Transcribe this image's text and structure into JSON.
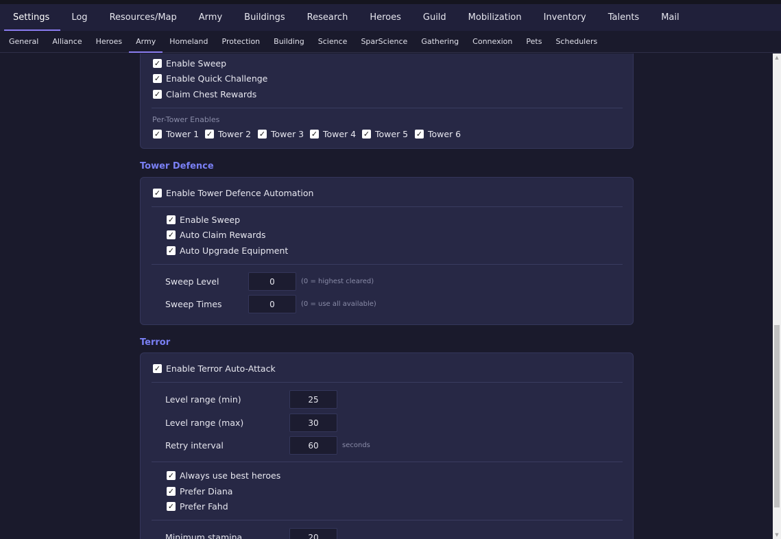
{
  "top_tabs": [
    "Settings",
    "Log",
    "Resources/Map",
    "Army",
    "Buildings",
    "Research",
    "Heroes",
    "Guild",
    "Mobilization",
    "Inventory",
    "Talents",
    "Mail"
  ],
  "sub_tabs": [
    "General",
    "Alliance",
    "Heroes",
    "Army",
    "Homeland",
    "Protection",
    "Building",
    "Science",
    "SparScience",
    "Gathering",
    "Connexion",
    "Pets",
    "Schedulers"
  ],
  "tower_card": {
    "enable_sweep": "Enable Sweep",
    "enable_quick_challenge": "Enable Quick Challenge",
    "claim_chest_rewards": "Claim Chest Rewards",
    "per_tower_label": "Per-Tower Enables",
    "towers": [
      "Tower 1",
      "Tower 2",
      "Tower 3",
      "Tower 4",
      "Tower 5",
      "Tower 6"
    ]
  },
  "tower_defence": {
    "title": "Tower Defence",
    "enable_automation": "Enable Tower Defence Automation",
    "enable_sweep": "Enable Sweep",
    "auto_claim_rewards": "Auto Claim Rewards",
    "auto_upgrade_equipment": "Auto Upgrade Equipment",
    "sweep_level_label": "Sweep Level",
    "sweep_level_value": "0",
    "sweep_level_hint": "(0 = highest cleared)",
    "sweep_times_label": "Sweep Times",
    "sweep_times_value": "0",
    "sweep_times_hint": "(0 = use all available)"
  },
  "terror": {
    "title": "Terror",
    "enable_auto_attack": "Enable Terror Auto-Attack",
    "level_min_label": "Level range (min)",
    "level_min_value": "25",
    "level_max_label": "Level range (max)",
    "level_max_value": "30",
    "retry_label": "Retry interval",
    "retry_value": "60",
    "retry_unit": "seconds",
    "always_best_heroes": "Always use best heroes",
    "prefer_diana": "Prefer Diana",
    "prefer_fahd": "Prefer Fahd",
    "min_stamina_label": "Minimum stamina",
    "min_stamina_value": "20"
  },
  "colors": {
    "accent": "#7a80f5",
    "background": "#1a1a2c",
    "card": "#272845"
  }
}
